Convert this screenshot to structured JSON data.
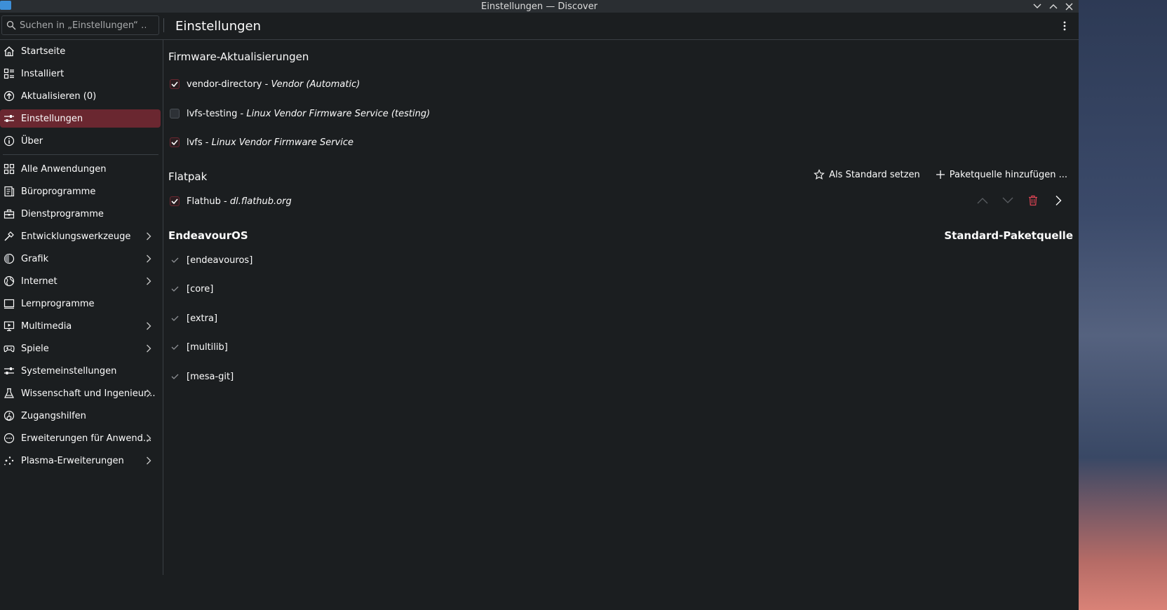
{
  "window": {
    "title": "Einstellungen — Discover"
  },
  "toolbar": {
    "search_placeholder": "Suchen in „Einstellungen“ …",
    "page_title": "Einstellungen"
  },
  "sidebar": {
    "primary": [
      {
        "label": "Startseite",
        "icon": "home-icon"
      },
      {
        "label": "Installiert",
        "icon": "installed-icon"
      },
      {
        "label": "Aktualisieren (0)",
        "icon": "update-icon"
      },
      {
        "label": "Einstellungen",
        "icon": "settings-icon",
        "active": true
      },
      {
        "label": "Über",
        "icon": "info-icon"
      }
    ],
    "categories": [
      {
        "label": "Alle Anwendungen",
        "icon": "grid-icon",
        "expandable": false
      },
      {
        "label": "Büroprogramme",
        "icon": "office-icon",
        "expandable": false
      },
      {
        "label": "Dienstprogramme",
        "icon": "toolbox-icon",
        "expandable": false
      },
      {
        "label": "Entwicklungswerkzeuge",
        "icon": "hammer-icon",
        "expandable": true
      },
      {
        "label": "Grafik",
        "icon": "graphics-icon",
        "expandable": true
      },
      {
        "label": "Internet",
        "icon": "globe-icon",
        "expandable": true
      },
      {
        "label": "Lernprogramme",
        "icon": "education-icon",
        "expandable": false
      },
      {
        "label": "Multimedia",
        "icon": "multimedia-icon",
        "expandable": true
      },
      {
        "label": "Spiele",
        "icon": "gamepad-icon",
        "expandable": true
      },
      {
        "label": "Systemeinstellungen",
        "icon": "sliders-icon",
        "expandable": false
      },
      {
        "label": "Wissenschaft und Ingenieur...",
        "icon": "flask-icon",
        "expandable": true
      },
      {
        "label": "Zugangshilfen",
        "icon": "accessibility-icon",
        "expandable": false
      },
      {
        "label": "Erweiterungen für Anwend...",
        "icon": "addons-icon",
        "expandable": true
      },
      {
        "label": "Plasma-Erweiterungen",
        "icon": "plasma-icon",
        "expandable": true
      }
    ]
  },
  "firmware": {
    "heading": "Firmware-Aktualisierungen",
    "sources": [
      {
        "name": "vendor-directory - ",
        "desc": "Vendor (Automatic)",
        "checked": true
      },
      {
        "name": "lvfs-testing - ",
        "desc": "Linux Vendor Firmware Service (testing)",
        "checked": false
      },
      {
        "name": "lvfs - ",
        "desc": "Linux Vendor Firmware Service",
        "checked": true
      }
    ]
  },
  "flatpak": {
    "heading": "Flatpak",
    "set_default_label": "Als Standard setzen",
    "add_source_label": "Paketquelle hinzufügen ...",
    "sources": [
      {
        "name": "Flathub - ",
        "desc": "dl.flathub.org",
        "checked": true
      }
    ]
  },
  "endeavouros": {
    "heading": "EndeavourOS",
    "default_label": "Standard-Paketquelle",
    "repos": [
      "[endeavouros]",
      "[core]",
      "[extra]",
      "[multilib]",
      "[mesa-git]"
    ]
  },
  "colors": {
    "accent": "#6a2730",
    "check": "#e8e8e8",
    "danger": "#da4453"
  }
}
